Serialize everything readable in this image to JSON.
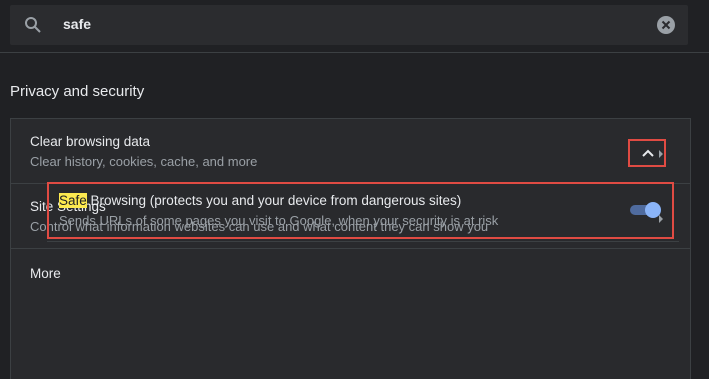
{
  "search": {
    "value": "safe",
    "icon": "search-icon",
    "clear_icon": "clear-icon"
  },
  "section": {
    "title": "Privacy and security"
  },
  "rows": [
    {
      "title": "Clear browsing data",
      "subtitle": "Clear history, cookies, cache, and more",
      "icon": "chevron-right-icon"
    },
    {
      "title": "Site Settings",
      "subtitle": "Control what information websites can use and what content they can show you",
      "icon": "chevron-right-icon"
    }
  ],
  "more": {
    "label": "More",
    "icon": "chevron-up-icon"
  },
  "safe_browsing": {
    "highlight": "Safe",
    "title_rest": " Browsing (protects you and your device from dangerous sites)",
    "subtitle": "Sends URLs of some pages you visit to Google, when your security is at risk",
    "toggle_state": "on"
  },
  "colors": {
    "background": "#202124",
    "card": "#292a2d",
    "accent": "#8ab4f8",
    "annotation_red": "#e04b43",
    "search_highlight": "#fce94f"
  }
}
